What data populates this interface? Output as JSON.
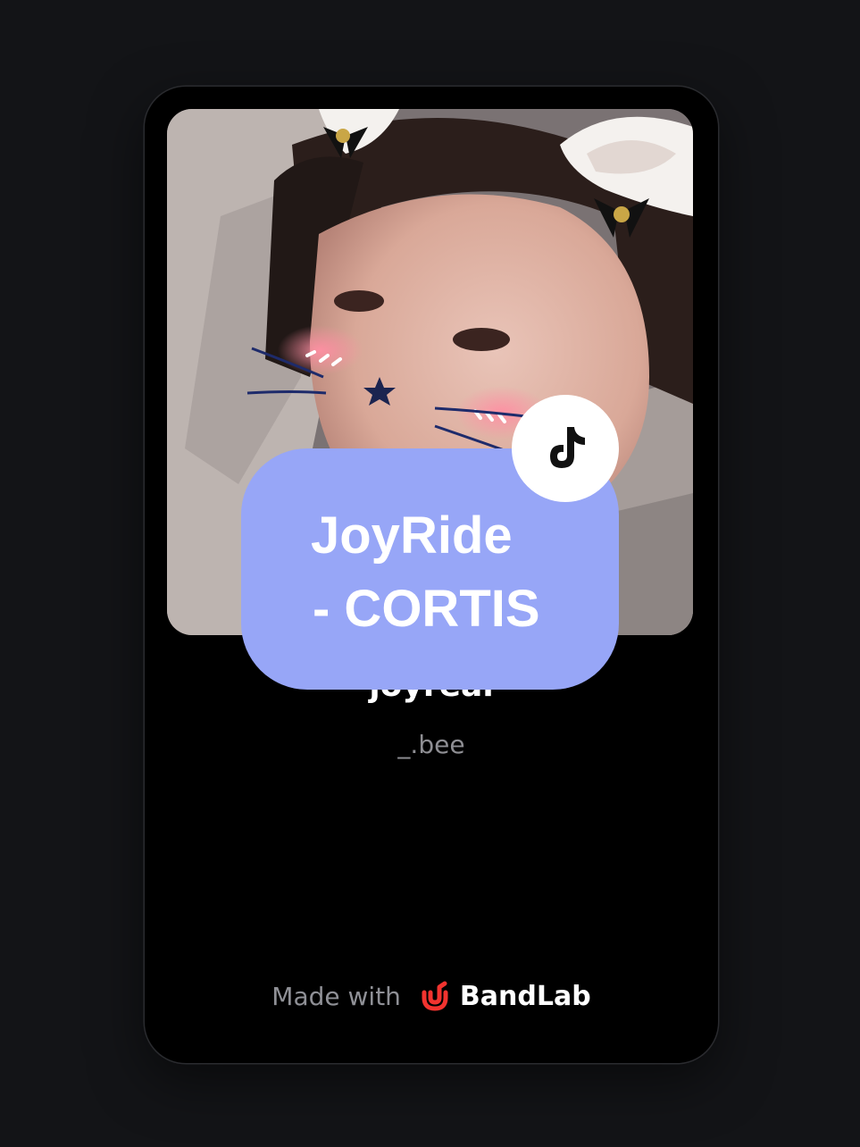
{
  "track": {
    "title": "joyreal",
    "artist": "_.bee"
  },
  "footer": {
    "made_with": "Made with",
    "brand": "BandLab"
  },
  "overlay": {
    "line1": "JoyRide",
    "line2": "- CORTIS"
  },
  "icons": {
    "brand_logo": "bandlab-logo-icon",
    "badge": "tiktok-icon"
  },
  "colors": {
    "page_bg": "#131417",
    "card_bg": "#000000",
    "overlay_bg": "#97a6f7",
    "brand_red": "#f2332f"
  }
}
